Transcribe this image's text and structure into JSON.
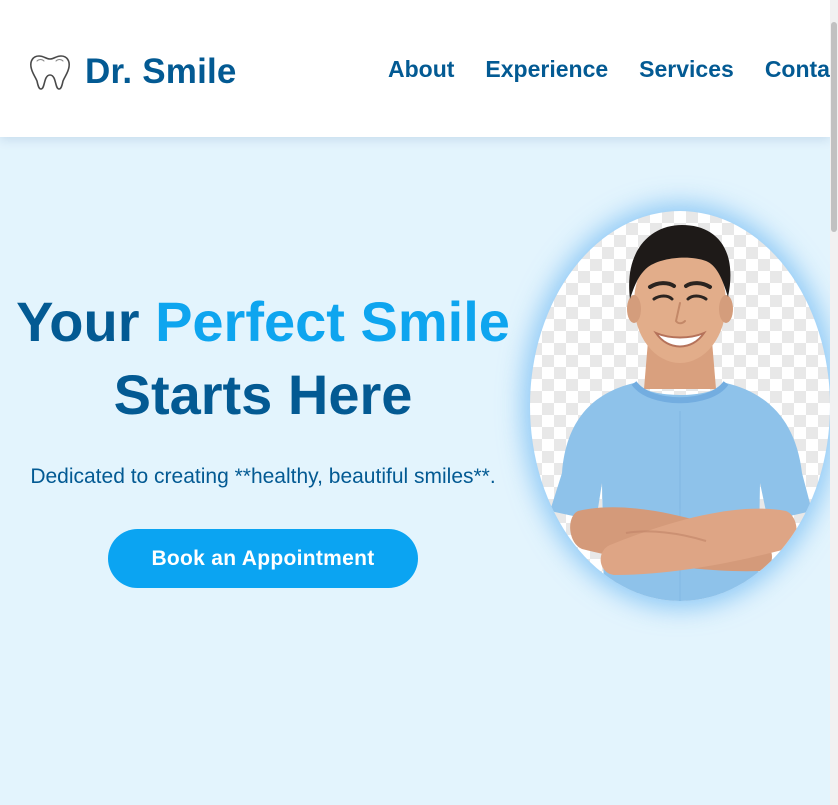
{
  "header": {
    "brand_name": "Dr. Smile",
    "logo_icon": "tooth-icon",
    "nav": [
      {
        "label": "About"
      },
      {
        "label": "Experience"
      },
      {
        "label": "Services"
      },
      {
        "label": "Contact"
      }
    ]
  },
  "hero": {
    "headline_part1": "Your ",
    "headline_accent": "Perfect Smile",
    "headline_line2": "Starts Here",
    "subtext": "Dedicated to creating **healthy, beautiful smiles**.",
    "cta_label": "Book an Appointment",
    "portrait_alt": "Smiling man with crossed arms"
  },
  "colors": {
    "primary_dark": "#035a93",
    "accent": "#0ea5ef",
    "button": "#0ba4f2",
    "hero_background": "#e3f4fd"
  }
}
